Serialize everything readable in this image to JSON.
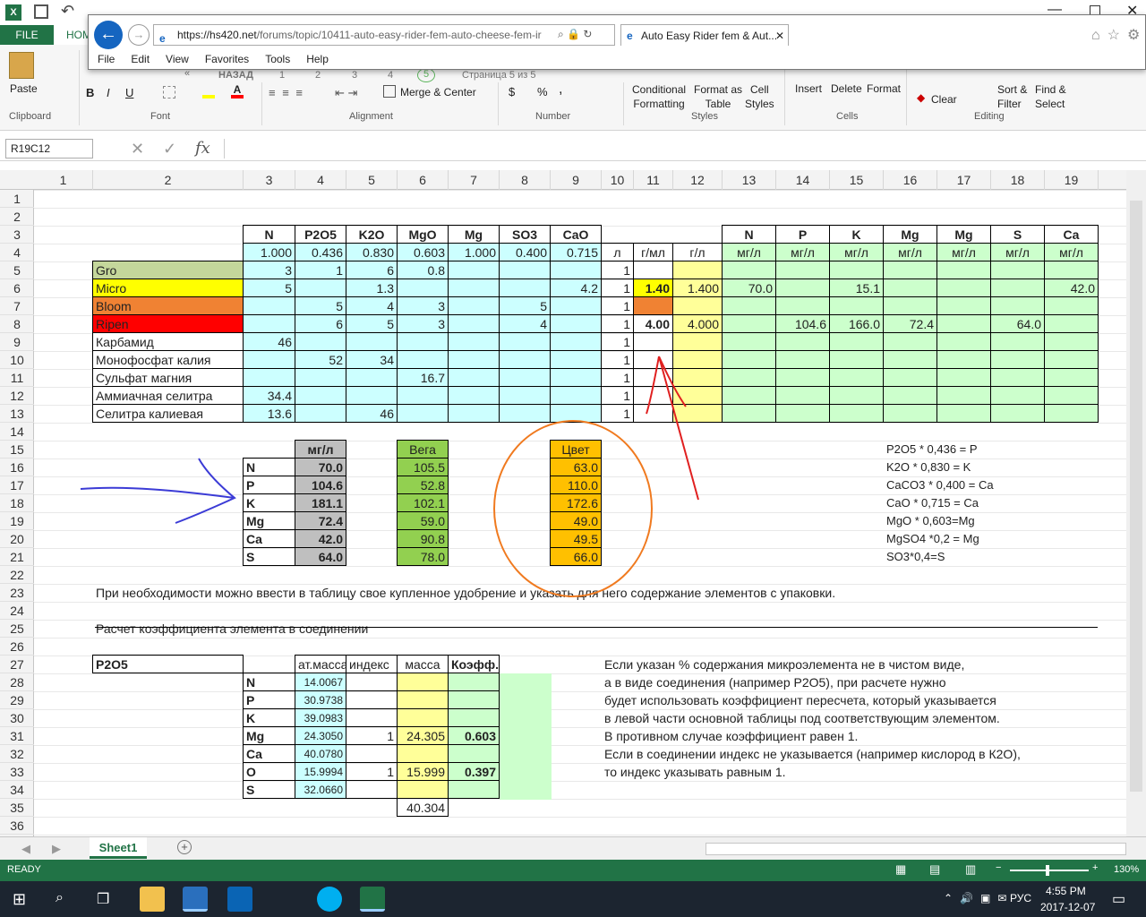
{
  "excel": {
    "file_tab": "FILE",
    "home_tab": "HOM",
    "cell_ref": "R19C12",
    "fx": "fx",
    "status": "READY",
    "zoom": "130%",
    "sheet_tab": "Sheet1"
  },
  "ribbon": {
    "paste": "Paste",
    "clipboard": "Clipboard",
    "font": "Font",
    "alignment": "Alignment",
    "number": "Number",
    "styles": "Styles",
    "cells": "Cells",
    "editing": "Editing",
    "merge": "Merge & Center",
    "cond": "Conditional",
    "cond2": "Formatting",
    "fmt_table": "Format as",
    "fmt_table2": "Table",
    "cell_styles": "Cell",
    "cell_styles2": "Styles",
    "insert": "Insert",
    "delete": "Delete",
    "format": "Format",
    "clear": "Clear",
    "sort": "Sort &",
    "sort2": "Filter",
    "find": "Find &",
    "find2": "Select",
    "bold": "B",
    "italic": "I",
    "underline": "U",
    "currency": "$",
    "percent": "%",
    "comma": ","
  },
  "browser": {
    "url_host": "https://hs420.net",
    "url_path": "/forums/topic/10411-auto-easy-rider-fem-auto-cheese-fem-ir",
    "tab": "Auto Easy Rider fem & Aut...",
    "menu": [
      "File",
      "Edit",
      "View",
      "Favorites",
      "Tools",
      "Help"
    ],
    "pager_back": "НАЗАД",
    "pages": [
      "1",
      "2",
      "3",
      "4",
      "5"
    ],
    "page_info": "Страница 5 из 5"
  },
  "columns": [
    "1",
    "2",
    "3",
    "4",
    "5",
    "6",
    "7",
    "8",
    "9",
    "10",
    "11",
    "12",
    "13",
    "14",
    "15",
    "16",
    "17",
    "18",
    "19"
  ],
  "rows": [
    "1",
    "2",
    "3",
    "4",
    "5",
    "6",
    "7",
    "8",
    "9",
    "10",
    "11",
    "12",
    "13",
    "14",
    "15",
    "16",
    "17",
    "18",
    "19",
    "20",
    "21",
    "22",
    "23",
    "24",
    "25",
    "26",
    "27",
    "28",
    "29",
    "30",
    "31",
    "32",
    "33",
    "34",
    "35",
    "36"
  ],
  "table1": {
    "headers": [
      "N",
      "P2O5",
      "K2O",
      "MgO",
      "Mg",
      "SO3",
      "CaO"
    ],
    "coef": [
      "1.000",
      "0.436",
      "0.830",
      "0.603",
      "1.000",
      "0.400",
      "0.715"
    ],
    "unit_l": "л",
    "unit_gml": "г/мл",
    "unit_gl": "г/л",
    "right_headers": [
      "N",
      "P",
      "K",
      "Mg",
      "Mg",
      "S",
      "Ca"
    ],
    "right_unit": "мг/л",
    "names": [
      "Gro",
      "Micro",
      "Bloom",
      "Ripen",
      "Карбамид",
      "Монофосфат калия",
      "Сульфат магния",
      "Аммиачная селитра",
      "Селитра калиевая"
    ],
    "row_colors": [
      "#c4d79b",
      "#ffff00",
      "#f08233",
      "#ff0000",
      "#ffffff",
      "#ffffff",
      "#ffffff",
      "#ffffff",
      "#ffffff"
    ],
    "vals": [
      [
        "3",
        "1",
        "6",
        "0.8",
        "",
        "",
        ""
      ],
      [
        "5",
        "",
        "1.3",
        "",
        "",
        "",
        "4.2"
      ],
      [
        "",
        "5",
        "4",
        "3",
        "",
        "5",
        ""
      ],
      [
        "",
        "6",
        "5",
        "3",
        "",
        "4",
        ""
      ],
      [
        "46",
        "",
        "",
        "",
        "",
        "",
        ""
      ],
      [
        "",
        "52",
        "34",
        "",
        "",
        "",
        ""
      ],
      [
        "",
        "",
        "",
        "16.7",
        "",
        "",
        ""
      ],
      [
        "34.4",
        "",
        "",
        "",
        "",
        "",
        ""
      ],
      [
        "13.6",
        "",
        "46",
        "",
        "",
        "",
        ""
      ]
    ],
    "liters": [
      "1",
      "1",
      "1",
      "1",
      "1",
      "1",
      "1",
      "1",
      "1"
    ],
    "gml": [
      "",
      "1.40",
      "",
      "4.00",
      "",
      "",
      "",
      "",
      ""
    ],
    "gl": [
      "",
      "1.400",
      "",
      "4.000",
      "",
      "",
      "",
      "",
      ""
    ],
    "right": [
      [
        "",
        "",
        "",
        "",
        "",
        "",
        ""
      ],
      [
        "70.0",
        "",
        "15.1",
        "",
        "",
        "",
        "42.0"
      ],
      [
        "",
        "",
        "",
        "",
        "",
        "",
        ""
      ],
      [
        "",
        "104.6",
        "166.0",
        "72.4",
        "",
        "64.0",
        ""
      ],
      [
        "",
        "",
        "",
        "",
        "",
        "",
        ""
      ],
      [
        "",
        "",
        "",
        "",
        "",
        "",
        ""
      ],
      [
        "",
        "",
        "",
        "",
        "",
        "",
        ""
      ],
      [
        "",
        "",
        "",
        "",
        "",
        "",
        ""
      ],
      [
        "",
        "",
        "",
        "",
        "",
        "",
        ""
      ]
    ]
  },
  "summary": {
    "mg_header": "мг/л",
    "vega_header": "Вега",
    "color_header": "Цвет",
    "elements": [
      "N",
      "P",
      "K",
      "Mg",
      "Ca",
      "S"
    ],
    "mg": [
      "70.0",
      "104.6",
      "181.1",
      "72.4",
      "42.0",
      "64.0"
    ],
    "vega": [
      "105.5",
      "52.8",
      "102.1",
      "59.0",
      "90.8",
      "78.0"
    ],
    "color": [
      "63.0",
      "110.0",
      "172.6",
      "49.0",
      "49.5",
      "66.0"
    ]
  },
  "formulas": [
    "P2O5 * 0,436 = P",
    "K2O * 0,830 = K",
    "CaCO3 * 0,400 = Ca",
    "CaO * 0,715 = Ca",
    "MgO * 0,603=Mg",
    "MgSO4 *0,2 = Mg",
    "SO3*0,4=S"
  ],
  "note23": "При необходимости можно ввести в таблицу свое купленное удобрение и указать для него содержание элементов с упаковки.",
  "title25": "Расчет коэффициента элемента в соединении",
  "calc": {
    "compound": "P2O5",
    "h_mass": "ат.масса",
    "h_index": "индекс",
    "h_weight": "масса",
    "h_coef": "Коэфф.",
    "elements": [
      "N",
      "P",
      "K",
      "Mg",
      "Ca",
      "O",
      "S"
    ],
    "atomic": [
      "14.0067",
      "30.9738",
      "39.0983",
      "24.3050",
      "40.0780",
      "15.9994",
      "32.0660"
    ],
    "index": [
      "",
      "",
      "",
      "1",
      "",
      "1",
      ""
    ],
    "weight": [
      "",
      "",
      "",
      "24.305",
      "",
      "15.999",
      ""
    ],
    "coef": [
      "",
      "",
      "",
      "0.603",
      "",
      "0.397",
      ""
    ],
    "total": "40.304"
  },
  "explain": [
    "Если указан % содержания микроэлемента не в чистом виде,",
    "а в виде соединения (например P2O5), при расчете нужно",
    "будет использовать коэффициент пересчета, который указывается",
    "в левой части основной таблицы под соответствующим элементом.",
    "В противном случае коэффициент равен 1.",
    "Если в соединении индекс не указывается (например кислород в К2О),",
    "то индекс указывать равным 1."
  ],
  "taskbar": {
    "lang": "РУС",
    "time": "4:55 PM",
    "date": "2017-12-07"
  },
  "colors": {
    "excel_green": "#217346",
    "arrow_blue": "#3b3bd6",
    "arrow_red": "#e02020",
    "circle_orange": "#f07a1f"
  }
}
